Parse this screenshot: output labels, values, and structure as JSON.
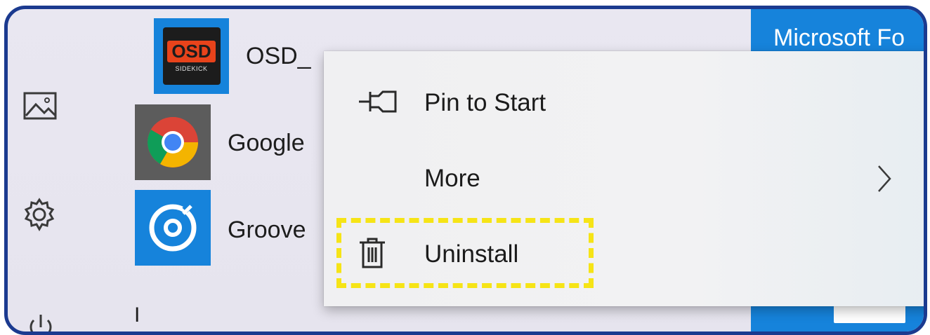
{
  "start_menu": {
    "left_rail": {
      "pictures_icon": "pictures-icon",
      "settings_icon": "gear-icon",
      "power_icon": "power-icon"
    },
    "apps": [
      {
        "label": "OSD_",
        "icon": "osd-sidekick-icon",
        "icon_text_top": "OSD",
        "icon_text_bottom": "SIDEKICK"
      },
      {
        "label": "Google",
        "icon": "chrome-icon"
      },
      {
        "label": "Groove",
        "icon": "groove-music-icon"
      }
    ],
    "section_letter": "I",
    "right_tile": {
      "label": "Microsoft Fo"
    }
  },
  "context_menu": {
    "items": [
      {
        "label": "Pin to Start",
        "icon": "pin-icon"
      },
      {
        "label": "More",
        "icon": "chevron-right-icon"
      },
      {
        "label": "Uninstall",
        "icon": "trash-icon"
      }
    ]
  },
  "colors": {
    "frame_border": "#1b3a8f",
    "highlight": "#f6e416",
    "tile_blue": "#1683db"
  }
}
